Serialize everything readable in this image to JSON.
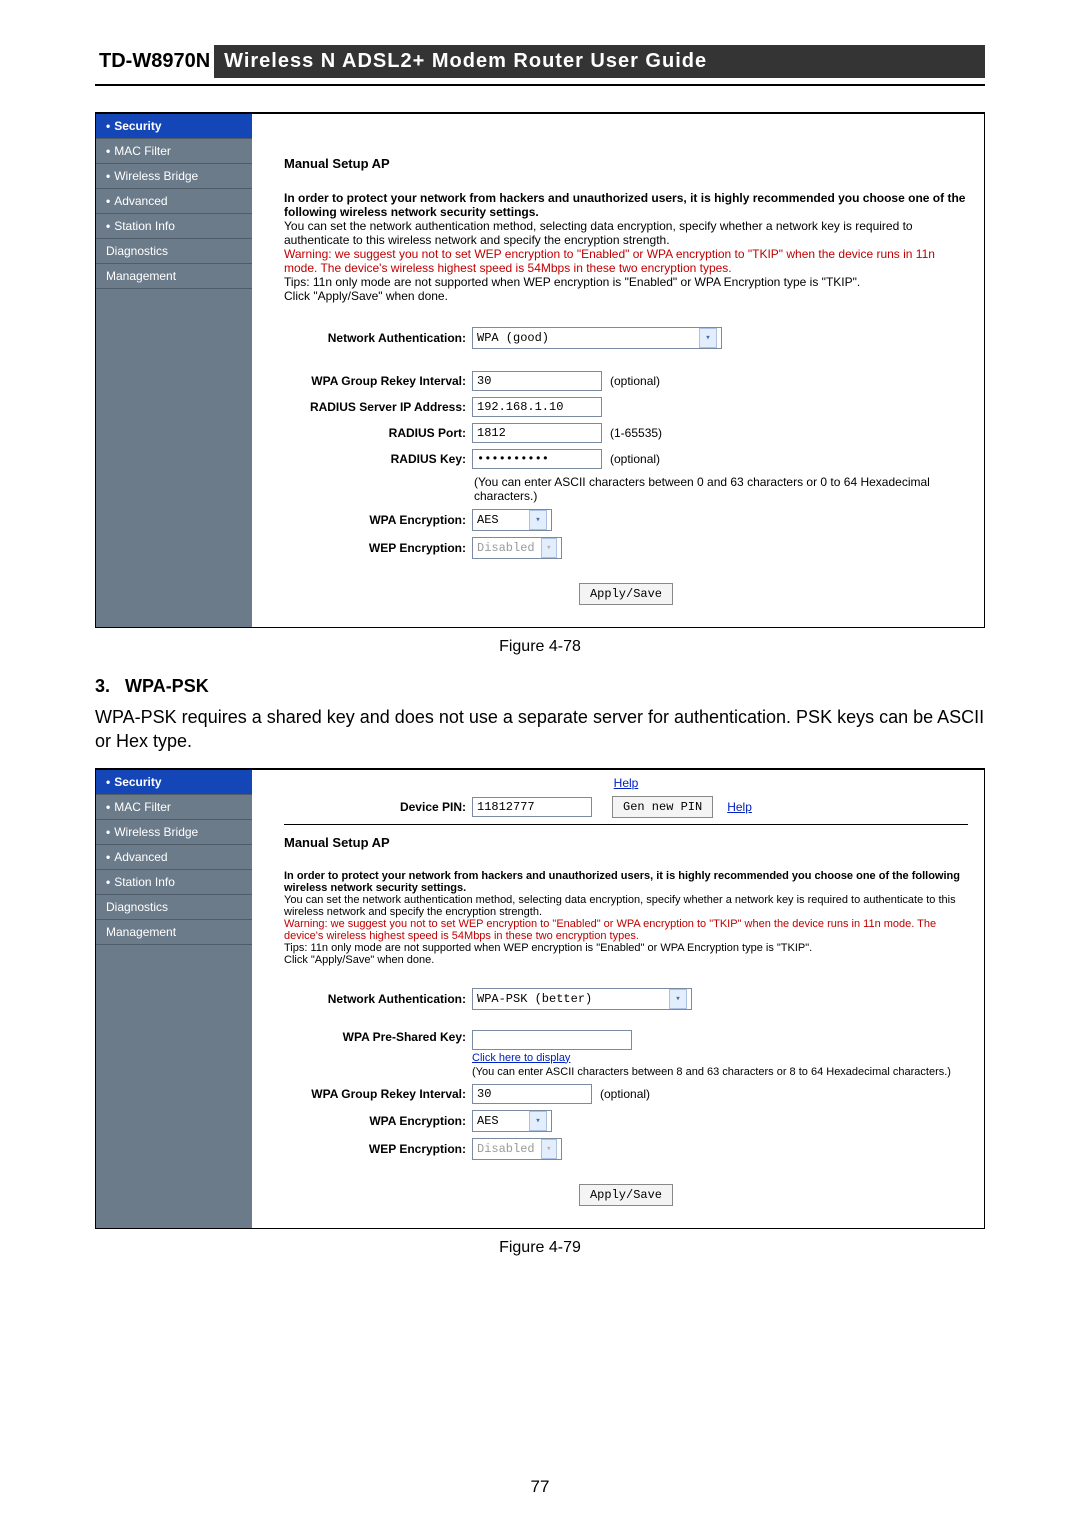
{
  "header": {
    "model": "TD-W8970N",
    "title": "Wireless  N  ADSL2+  Modem  Router  User  Guide"
  },
  "sidebar": {
    "items": [
      "Security",
      "MAC Filter",
      "Wireless Bridge",
      "Advanced",
      "Station Info",
      "Diagnostics",
      "Management"
    ]
  },
  "fig78": {
    "heading": "Manual Setup AP",
    "intro_bold": "In order to protect your network from hackers and unauthorized users, it is highly recommended you choose one of the following wireless network security settings.",
    "intro2": "You can set the network authentication method, selecting data encryption, specify whether a network key is required to authenticate to this wireless network and specify the encryption strength.",
    "warn": "Warning: we suggest you not to set WEP encryption to \"Enabled\" or WPA encryption to \"TKIP\" when the device runs in 11n mode. The device's wireless highest speed is 54Mbps in these two encryption types.",
    "tip": "Tips: 11n only mode are not supported when WEP encryption is \"Enabled\" or WPA Encryption type is \"TKIP\".",
    "click": "Click \"Apply/Save\" when done.",
    "labels": {
      "netauth": "Network Authentication:",
      "rekey": "WPA Group Rekey Interval:",
      "radiusip": "RADIUS Server IP Address:",
      "radiusport": "RADIUS Port:",
      "radiuskey": "RADIUS Key:",
      "wpaenc": "WPA Encryption:",
      "wepenc": "WEP Encryption:"
    },
    "values": {
      "netauth": "WPA (good)",
      "rekey": "30",
      "radiusip": "192.168.1.10",
      "radiusport": "1812",
      "radiuskey": "••••••••••",
      "wpaenc": "AES",
      "wepenc": "Disabled"
    },
    "hints": {
      "optional": "(optional)",
      "portrange": "(1-65535)",
      "keynote": "(You can enter ASCII characters between 0 and 63 characters or 0 to 64 Hexadecimal characters.)"
    },
    "apply": "Apply/Save",
    "caption": "Figure 4-78"
  },
  "section": {
    "num": "3.",
    "title": "WPA-PSK",
    "text": "WPA-PSK requires a shared key and does not use a separate server for authentication. PSK keys can be ASCII or Hex type."
  },
  "fig79": {
    "help": "Help",
    "pin_label": "Device PIN:",
    "pin_value": "11812777",
    "genpin": "Gen new PIN",
    "heading": "Manual Setup AP",
    "intro_bold": "In order to protect your network from hackers and unauthorized users, it is highly recommended you choose one of the following wireless network security settings.",
    "intro2": "You can set the network authentication method, selecting data encryption, specify whether a network key is required to authenticate to this wireless network and specify the encryption strength.",
    "warn": "Warning: we suggest you not to set WEP encryption to \"Enabled\" or WPA encryption to \"TKIP\" when the device runs in 11n mode. The device's wireless highest speed is 54Mbps in these two encryption types.",
    "tip": "Tips: 11n only mode are not supported when WEP encryption is \"Enabled\" or WPA Encryption type is \"TKIP\".",
    "click": "Click \"Apply/Save\" when done.",
    "labels": {
      "netauth": "Network Authentication:",
      "psk": "WPA Pre-Shared Key:",
      "clickdisp": "Click here to display",
      "psknote": "(You can enter ASCII characters between 8 and 63 characters or 8 to 64 Hexadecimal characters.)",
      "rekey": "WPA Group Rekey Interval:",
      "wpaenc": "WPA Encryption:",
      "wepenc": "WEP Encryption:"
    },
    "values": {
      "netauth": "WPA-PSK (better)",
      "psk": "",
      "rekey": "30",
      "wpaenc": "AES",
      "wepenc": "Disabled"
    },
    "optional": "(optional)",
    "apply": "Apply/Save",
    "caption": "Figure 4-79"
  },
  "pagenum": "77"
}
